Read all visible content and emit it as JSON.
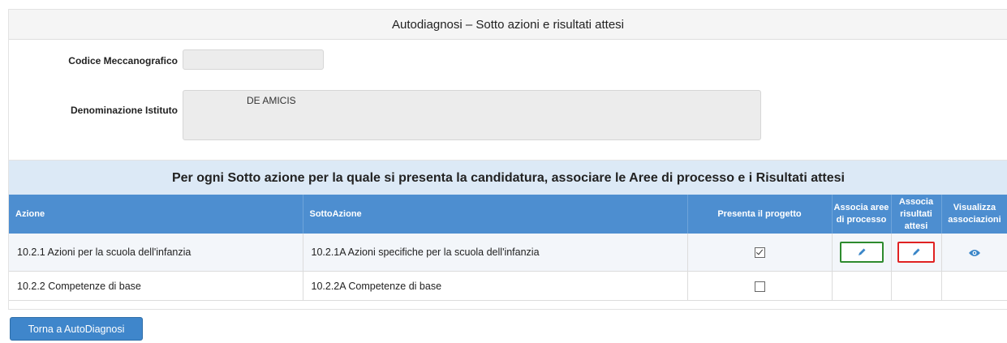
{
  "panel": {
    "title": "Autodiagnosi – Sotto azioni e risultati attesi"
  },
  "info": {
    "codice_label": "Codice Meccanografico",
    "codice_value": "",
    "denominazione_label": "Denominazione Istituto",
    "denominazione_value": "DE AMICIS"
  },
  "section": {
    "title": "Per ogni Sotto azione per la quale si presenta la candidatura, associare le Aree di processo e i Risultati attesi"
  },
  "table": {
    "headers": {
      "azione": "Azione",
      "sottoazione": "SottoAzione",
      "presenta": "Presenta il progetto",
      "associa_aree": "Associa aree di processo",
      "associa_risultati": "Associa risultati attesi",
      "visualizza": "Visualizza associazioni"
    },
    "rows": [
      {
        "azione": "10.2.1 Azioni per la scuola dell'infanzia",
        "sottoazione": "10.2.1A Azioni specifiche per la scuola dell'infanzia",
        "presenta": true
      },
      {
        "azione": "10.2.2 Competenze di base",
        "sottoazione": "10.2.2A Competenze di base",
        "presenta": false
      }
    ]
  },
  "footer": {
    "back_button": "Torna a AutoDiagnosi"
  },
  "colors": {
    "header_blue": "#4d8ed0",
    "section_bg": "#dce9f6",
    "button_blue": "#3f86cb",
    "edit_green_border": "#2e8b2e",
    "edit_red_border": "#e02222"
  }
}
